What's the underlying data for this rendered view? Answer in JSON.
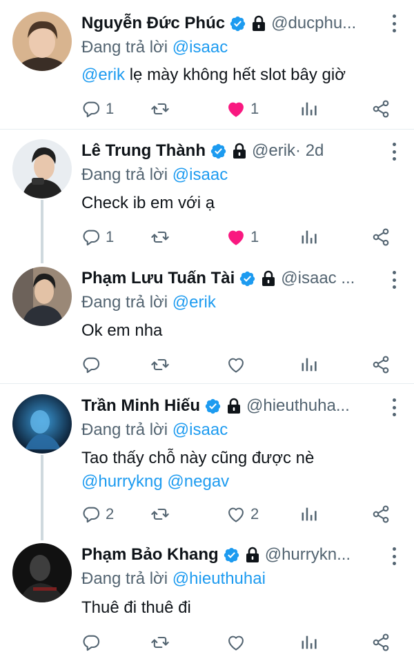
{
  "tweets": [
    {
      "name": "Nguyễn Đức Phúc",
      "handle": "@ducphu...",
      "time": "",
      "reply_prefix": "Đang trả lời",
      "reply_to": "@isaac",
      "body_mention": "@erik",
      "body_text": " lẹ mày không hết slot bây giờ",
      "body_line2": "",
      "body_mentions2": [],
      "reply_count": "1",
      "retweet_count": "",
      "like_count": "1",
      "liked": true,
      "avatar_colors": [
        "#caa98a",
        "#4a3a2e"
      ]
    },
    {
      "name": "Lê Trung Thành",
      "handle": "@erik",
      "time": " · 2d",
      "reply_prefix": "Đang trả lời",
      "reply_to": "@isaac",
      "body_mention": "",
      "body_text": "Check ib em với ạ",
      "body_line2": "",
      "body_mentions2": [],
      "reply_count": "1",
      "retweet_count": "",
      "like_count": "1",
      "liked": true,
      "avatar_colors": [
        "#e9edf1",
        "#2b2b2b"
      ]
    },
    {
      "name": "Phạm Lưu Tuấn Tài",
      "handle": "@isaac ...",
      "time": "",
      "reply_prefix": "Đang trả lời",
      "reply_to": "@erik",
      "body_mention": "",
      "body_text": "Ok em nha",
      "body_line2": "",
      "body_mentions2": [],
      "reply_count": "",
      "retweet_count": "",
      "like_count": "",
      "liked": false,
      "avatar_colors": [
        "#8e7b6a",
        "#2a2d33"
      ]
    },
    {
      "name": "Trần Minh Hiếu",
      "handle": "@hieuthuha...",
      "time": "",
      "reply_prefix": "Đang trả lời",
      "reply_to": "@isaac",
      "body_mention": "",
      "body_text": "Tao thấy chỗ này cũng được nè",
      "body_line2": "",
      "body_mentions2": [
        "@hurrykng",
        "@negav"
      ],
      "reply_count": "2",
      "retweet_count": "",
      "like_count": "2",
      "liked": false,
      "avatar_colors": [
        "#0d1b2e",
        "#2f7db8"
      ]
    },
    {
      "name": "Phạm Bảo Khang",
      "handle": "@hurrykn...",
      "time": "",
      "reply_prefix": "Đang trả lời",
      "reply_to": "@hieuthuhai",
      "body_mention": "",
      "body_text": "Thuê đi thuê đi",
      "body_line2": "",
      "body_mentions2": [],
      "reply_count": "",
      "retweet_count": "",
      "like_count": "",
      "liked": false,
      "avatar_colors": [
        "#1a1a1a",
        "#5a5a5a"
      ]
    }
  ],
  "icons": {
    "verified": "verified-badge-icon",
    "lock": "lock-icon",
    "reply": "reply-icon",
    "retweet": "retweet-icon",
    "like": "heart-icon",
    "stats": "stats-icon",
    "share": "share-icon",
    "more": "more-icon"
  },
  "colors": {
    "mention": "#1d9bf0",
    "liked": "#f91880",
    "secondary": "#536471",
    "verified": "#1d9bf0"
  }
}
